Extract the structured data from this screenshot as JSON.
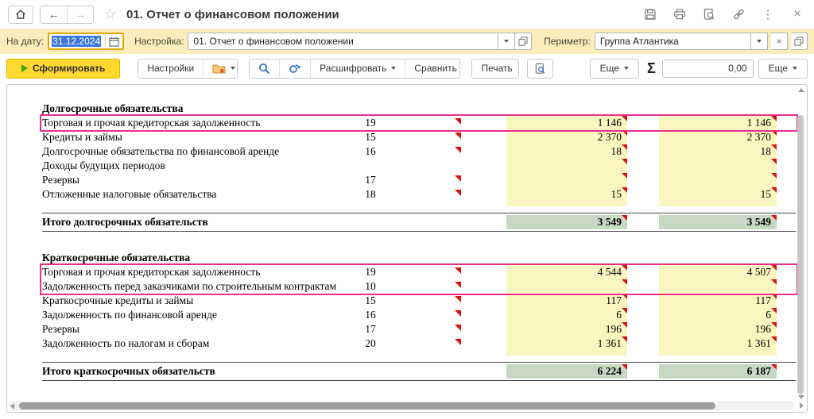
{
  "header": {
    "title": "01. Отчет о финансовом положении",
    "icons": {
      "home": "home",
      "back": "←",
      "forward": "→",
      "star": "☆",
      "kebab": "⋮",
      "close": "×"
    }
  },
  "filters": {
    "date_label": "На дату:",
    "date_value": "31.12.2024",
    "setting_label": "Настройка:",
    "setting_value": "01. Отчет о финансовом положении",
    "perimeter_label": "Периметр:",
    "perimeter_value": "Группа Атлантика",
    "clear_glyph": "×"
  },
  "toolbar": {
    "generate_label": "Сформировать",
    "settings_label": "Настройки",
    "decrypt_label": "Расшифровать",
    "compare_label": "Сравнить",
    "print_label": "Печать",
    "more_label_1": "Еще",
    "sigma_label": "Σ",
    "sum_value": "0,00",
    "more_label_2": "Еще"
  },
  "colors": {
    "filter_bar": "#faedbb",
    "generate_button": "#ffd92e",
    "cell_yellow": "#fbf6c0",
    "cell_green": "#c7d9c2",
    "highlight_pink": "#ea2e8b",
    "comment_red": "#e01010"
  },
  "table": {
    "sections": [
      {
        "title": "Долгосрочные обязательства",
        "rows": [
          {
            "label": "Торговая и прочая кредиторская задолженность",
            "note": "19",
            "flag": true,
            "v1": "1 146",
            "v2": "1 146",
            "t1": true,
            "t2": true,
            "hl": "hl1"
          },
          {
            "label": "Кредиты и займы",
            "note": "15",
            "flag": true,
            "v1": "2 370",
            "v2": "2 370",
            "t1": true,
            "t2": true
          },
          {
            "label": "Долгосрочные обязательства по финансовой аренде",
            "note": "16",
            "flag": true,
            "v1": "18",
            "v2": "18",
            "t1": true,
            "t2": true
          },
          {
            "label": "Доходы будущих периодов",
            "note": "",
            "flag": false,
            "v1": "",
            "v2": "",
            "t1": true,
            "t2": true
          },
          {
            "label": "Резервы",
            "note": "17",
            "flag": true,
            "v1": "",
            "v2": "",
            "t1": true,
            "t2": true
          },
          {
            "label": "Отложенные налоговые обязательства",
            "note": "18",
            "flag": true,
            "v1": "15",
            "v2": "15",
            "t1": true,
            "t2": true
          }
        ],
        "total": {
          "label": "Итого долгосрочных обязательств",
          "v1": "3 549",
          "v2": "3 549",
          "t1": true,
          "t2": true
        }
      },
      {
        "title": "Краткосрочные обязательства",
        "rows": [
          {
            "label": "Торговая и прочая кредиторская задолженность",
            "note": "19",
            "flag": true,
            "v1": "4 544",
            "v2": "4 507",
            "t1": true,
            "t2": true,
            "hl": "hl2"
          },
          {
            "label": "Задолженность перед заказчиками по строительным контрактам",
            "note": "10",
            "flag": true,
            "v1": "",
            "v2": "",
            "t1": true,
            "t2": true,
            "hl": "hl2"
          },
          {
            "label": "Краткосрочные кредиты и займы",
            "note": "15",
            "flag": true,
            "v1": "117",
            "v2": "117",
            "t1": true,
            "t2": true
          },
          {
            "label": "Задолженность по финансовой аренде",
            "note": "16",
            "flag": true,
            "v1": "6",
            "v2": "6",
            "t1": true,
            "t2": true
          },
          {
            "label": "Резервы",
            "note": "17",
            "flag": true,
            "v1": "196",
            "v2": "196",
            "t1": true,
            "t2": true
          },
          {
            "label": "Задолженность по налогам и сборам",
            "note": "20",
            "flag": true,
            "v1": "1 361",
            "v2": "1 361",
            "t1": true,
            "t2": true
          }
        ],
        "total": {
          "label": "Итого краткосрочных обязательств",
          "v1": "6 224",
          "v2": "6 187",
          "t1": true,
          "t2": true
        }
      }
    ]
  }
}
